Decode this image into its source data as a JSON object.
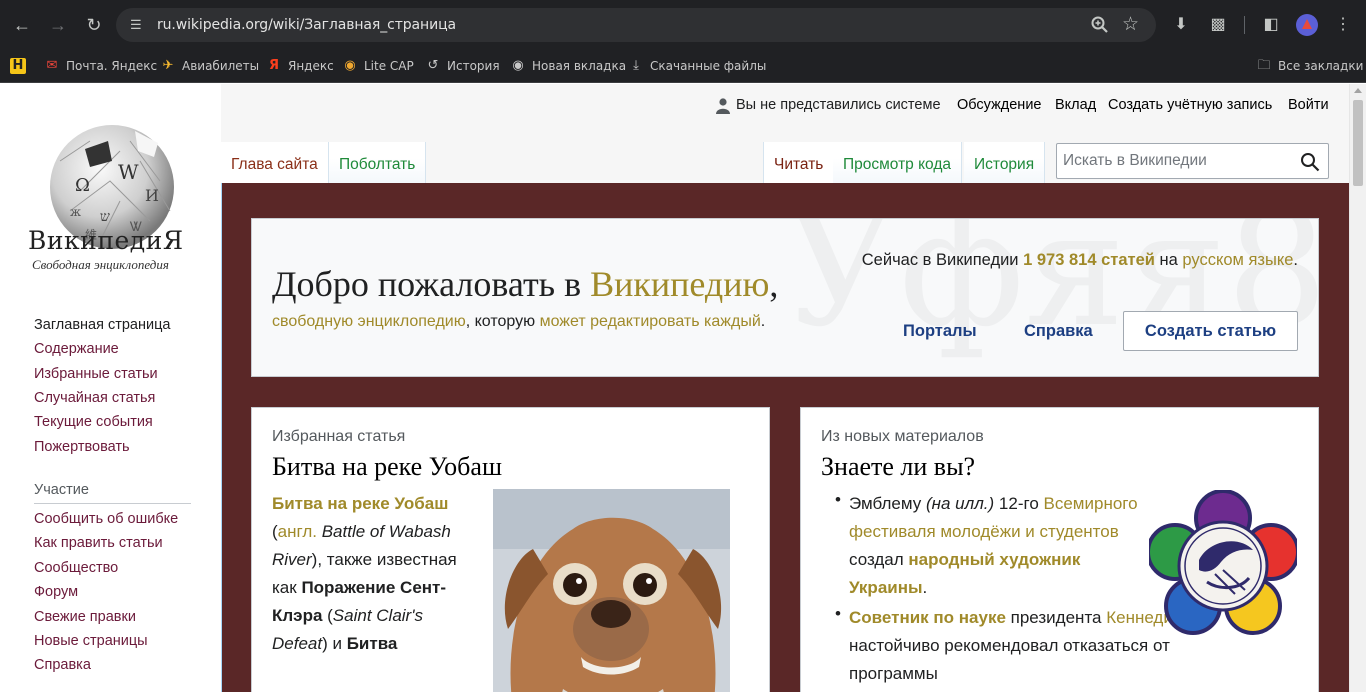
{
  "browser": {
    "url": "ru.wikipedia.org/wiki/Заглавная_страница",
    "bookmarks": [
      {
        "label": "Почта. Яндекс",
        "icon": "mail-icon"
      },
      {
        "label": "Авиабилеты",
        "icon": "plane-icon"
      },
      {
        "label": "Яндекс",
        "icon": "yandex-icon"
      },
      {
        "label": "Lite CAP",
        "icon": "cap-icon"
      },
      {
        "label": "История",
        "icon": "history-icon"
      },
      {
        "label": "Новая вкладка",
        "icon": "globe-icon"
      },
      {
        "label": "Скачанные файлы",
        "icon": "download-icon"
      }
    ],
    "all_bookmarks": "Все закладки"
  },
  "logo": {
    "wordmark": "ВикипедиЯ",
    "tagline": "Свободная энциклопедия"
  },
  "sidebar": {
    "nav": [
      "Заглавная страница",
      "Содержание",
      "Избранные статьи",
      "Случайная статья",
      "Текущие события",
      "Пожертвовать"
    ],
    "participation_heading": "Участие",
    "participation": [
      "Сообщить об ошибке",
      "Как править статьи",
      "Сообщество",
      "Форум",
      "Свежие правки",
      "Новые страницы",
      "Справка"
    ]
  },
  "personal": {
    "not_logged_in": "Вы не представились системе",
    "talk": "Обсуждение",
    "contributions": "Вклад",
    "create_account": "Создать учётную запись",
    "login": "Войти"
  },
  "tabs": {
    "main": "Глава сайта",
    "talk": "Поболтать",
    "read": "Читать",
    "view_source": "Просмотр кода",
    "history": "История"
  },
  "search": {
    "placeholder": "Искать в Википедии"
  },
  "welcome": {
    "title_prefix": "Добро пожаловать в ",
    "title_link": "Википедию",
    "title_suffix": ",",
    "sub_link1": "свободную энциклопедию",
    "sub_mid": ", которую ",
    "sub_link2": "может редактировать каждый",
    "sub_end": ".",
    "stats_prefix": "Сейчас в Википедии ",
    "stats_count": "1 973 814 статей",
    "stats_mid": " на ",
    "stats_lang": "русском языке",
    "stats_end": ".",
    "portals": "Порталы",
    "help": "Справка",
    "create_article": "Создать статью"
  },
  "featured": {
    "label": "Избранная статья",
    "title": "Битва на реке Уобаш",
    "bold_title": "Битва на реке Уобаш",
    "open_paren": " (",
    "lang": "англ.",
    "en_name": " Battle of Wabash River",
    "after": "), также известная как ",
    "alt_name": "Поражение Сент-Клэра",
    "alt_paren_open": " (",
    "alt_en": "Saint Clair's Defeat",
    "alt_paren_close": ") и ",
    "last_bold": "Битва"
  },
  "dyk": {
    "label": "Из новых материалов",
    "title": "Знаете ли вы?",
    "item1_a": "Эмблему ",
    "item1_ill": "(на илл.)",
    "item1_b": " 12-го ",
    "item1_link": "Всемирного фестиваля молодёжи и студентов",
    "item1_c": " создал ",
    "item1_bold": "народный художник Украины",
    "item1_d": ".",
    "item2_bold": "Советник по науке",
    "item2_a": " президента ",
    "item2_link": "Кеннеди",
    "item2_b": " настойчиво рекомендовал отказаться от программы"
  }
}
